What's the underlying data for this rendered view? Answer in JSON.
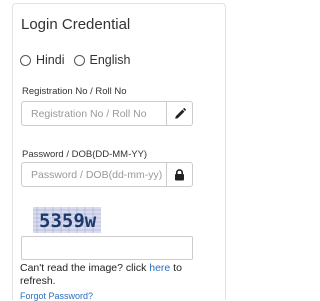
{
  "panel": {
    "title": "Login Credential"
  },
  "language": {
    "options": [
      {
        "label": "Hindi",
        "selected": false
      },
      {
        "label": "English",
        "selected": false
      }
    ]
  },
  "registration": {
    "label": "Registration No / Roll No",
    "placeholder": "Registration No / Roll No",
    "value": "",
    "icon": "pencil-icon"
  },
  "password": {
    "label": "Password / DOB(DD-MM-YY)",
    "placeholder": "Password / DOB(dd-mm-yy)",
    "value": "",
    "icon": "lock-icon"
  },
  "captcha": {
    "image_text": "5359w",
    "input_value": "",
    "refresh_prefix": "Can't read the image? click ",
    "refresh_link": "here",
    "refresh_suffix": " to refresh."
  },
  "links": {
    "forgot_password": "Forgot Password?"
  },
  "colors": {
    "link": "#2a6fbf",
    "border": "#cccccc",
    "captcha_text": "#1b3a6b"
  }
}
